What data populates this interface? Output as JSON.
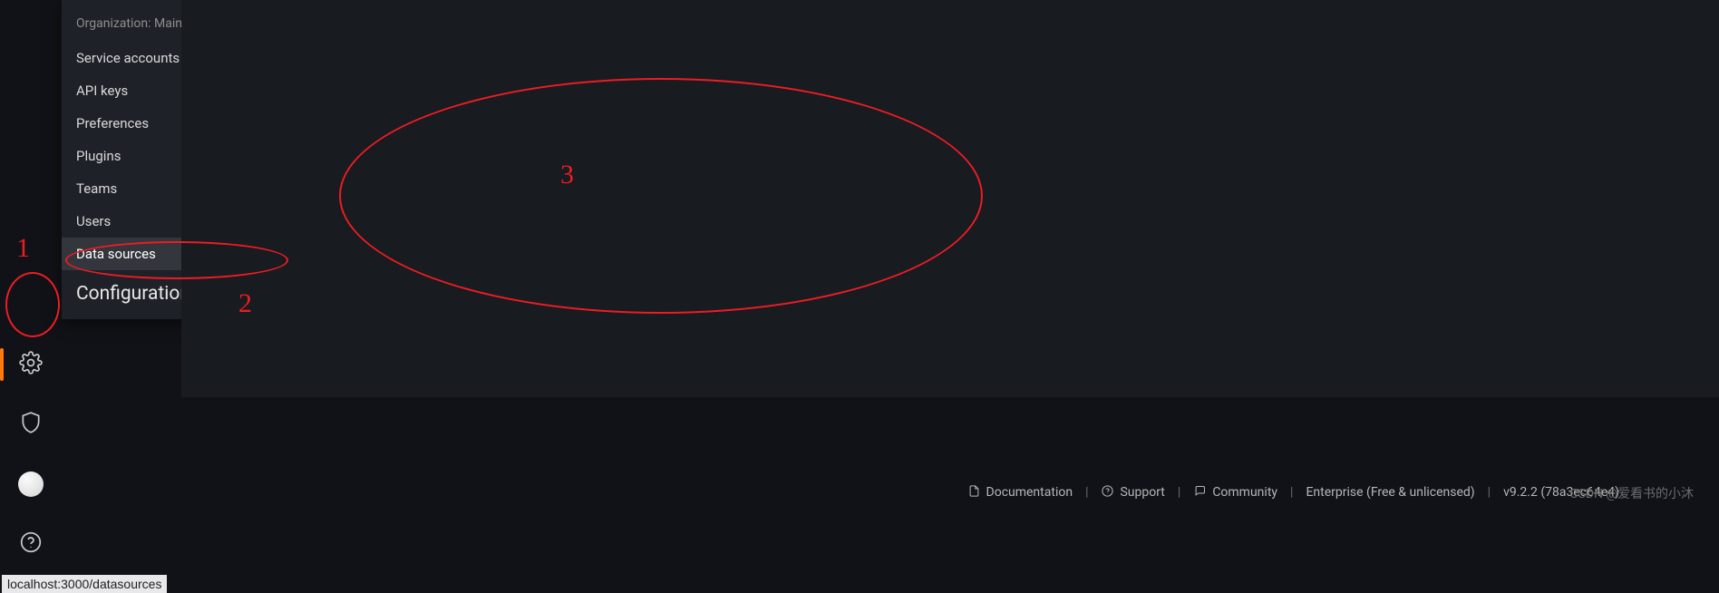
{
  "sidebar": {
    "items": [
      {
        "id": "config",
        "icon": "gear-icon",
        "active": true
      },
      {
        "id": "admin",
        "icon": "shield-icon",
        "active": false
      },
      {
        "id": "profile",
        "icon": "avatar",
        "active": false
      },
      {
        "id": "help",
        "icon": "question-icon",
        "active": false
      }
    ]
  },
  "popup": {
    "header": "Organization: Main Org.",
    "title": "Configuration",
    "items": [
      {
        "label": "Service accounts",
        "highlighted": false
      },
      {
        "label": "API keys",
        "highlighted": false
      },
      {
        "label": "Preferences",
        "highlighted": false
      },
      {
        "label": "Plugins",
        "highlighted": false
      },
      {
        "label": "Teams",
        "highlighted": false
      },
      {
        "label": "Users",
        "highlighted": false
      },
      {
        "label": "Data sources",
        "highlighted": true
      }
    ]
  },
  "footer": {
    "documentation": "Documentation",
    "support": "Support",
    "community": "Community",
    "enterprise": "Enterprise (Free & unlicensed)",
    "version": "v9.2.2 (78a3ec64e4)"
  },
  "statusbar": {
    "url": "localhost:3000/datasources"
  },
  "watermark": "CSDN @爱看书的小沐",
  "annotations": {
    "labels": [
      "1",
      "2",
      "3"
    ]
  }
}
